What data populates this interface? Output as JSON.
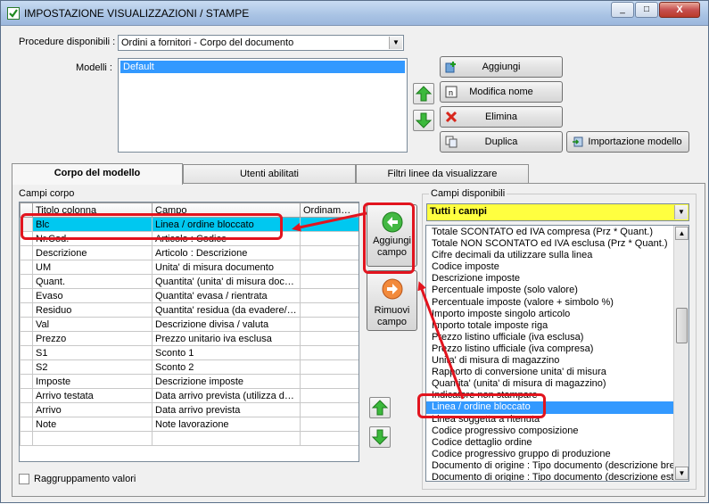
{
  "window": {
    "title": "IMPOSTAZIONE VISUALIZZAZIONI / STAMPE",
    "controls": [
      "_",
      "□",
      "X"
    ]
  },
  "procedure": {
    "label": "Procedure disponibili :",
    "value": "Ordini a fornitori - Corpo del documento"
  },
  "modelli": {
    "label": "Modelli :",
    "items": [
      "Default"
    ]
  },
  "buttons": {
    "aggiungi": "Aggiungi",
    "modifica_nome": "Modifica nome",
    "elimina": "Elimina",
    "duplica": "Duplica",
    "importazione_modello": "Importazione modello",
    "aggiungi_campo_line1": "Aggiungi",
    "aggiungi_campo_line2": "campo",
    "rimuovi_campo_line1": "Rimuovi",
    "rimuovi_campo_line2": "campo"
  },
  "tabs": [
    "Corpo del modello",
    "Utenti abilitati",
    "Filtri linee da visualizzare"
  ],
  "campi_corpo": {
    "label": "Campi corpo",
    "columns": [
      "Titolo colonna",
      "Campo",
      "Ordinamento"
    ],
    "rows": [
      [
        "Blc",
        "Linea / ordine bloccato",
        ""
      ],
      [
        "Nr.Cod.",
        "Articolo : Codice",
        ""
      ],
      [
        "Descrizione",
        "Articolo : Descrizione",
        ""
      ],
      [
        "UM",
        "Unita' di misura documento",
        ""
      ],
      [
        "Quant.",
        "Quantita' (unita' di misura docum...",
        ""
      ],
      [
        "Evaso",
        "Quantita' evasa / rientrata",
        ""
      ],
      [
        "Residuo",
        "Quantita' residua (da evadere/a...",
        ""
      ],
      [
        "Val",
        "Descrizione divisa / valuta",
        ""
      ],
      [
        "Prezzo",
        "Prezzo unitario iva esclusa",
        ""
      ],
      [
        "S1",
        "Sconto 1",
        ""
      ],
      [
        "S2",
        "Sconto 2",
        ""
      ],
      [
        "Imposte",
        "Descrizione imposte",
        ""
      ],
      [
        "Arrivo testata",
        "Data arrivo prevista (utilizza dat...",
        ""
      ],
      [
        "Arrivo",
        "Data arrivo prevista",
        ""
      ],
      [
        "Note",
        "Note lavorazione",
        ""
      ]
    ]
  },
  "raggruppamento": {
    "label": "Raggruppamento valori"
  },
  "campi_disponibili": {
    "label": "Campi disponibili",
    "filter": "Tutti i campi",
    "items": [
      "Totale SCONTATO ed IVA compresa (Prz * Quant.)",
      "Totale NON SCONTATO ed IVA esclusa (Prz * Quant.)",
      "Cifre decimali da utilizzare sulla linea",
      "Codice imposte",
      "Descrizione imposte",
      "Percentuale imposte (solo valore)",
      "Percentuale imposte (valore + simbolo %)",
      "Importo imposte singolo articolo",
      "Importo totale imposte riga",
      "Prezzo listino ufficiale (iva esclusa)",
      "Prezzo listino ufficiale (iva compresa)",
      "Unita' di misura di magazzino",
      "Rapporto di conversione unita' di misura",
      "Quantita' (unita' di misura di magazzino)",
      "Indicatore non stampare",
      "Linea / ordine bloccato",
      "Linea soggetta a ritenuta",
      "Codice progressivo composizione",
      "Codice dettaglio ordine",
      "Codice progressivo gruppo di produzione",
      "Documento di origine : Tipo documento (descrizione breve)",
      "Documento di origine : Tipo documento (descrizione estesa)"
    ],
    "selected_index": 15
  },
  "colors": {
    "selected_row": "#00c8f0",
    "list_selection": "#3399ff",
    "filter_background": "#ffff40",
    "annotation": "#e2141e"
  }
}
